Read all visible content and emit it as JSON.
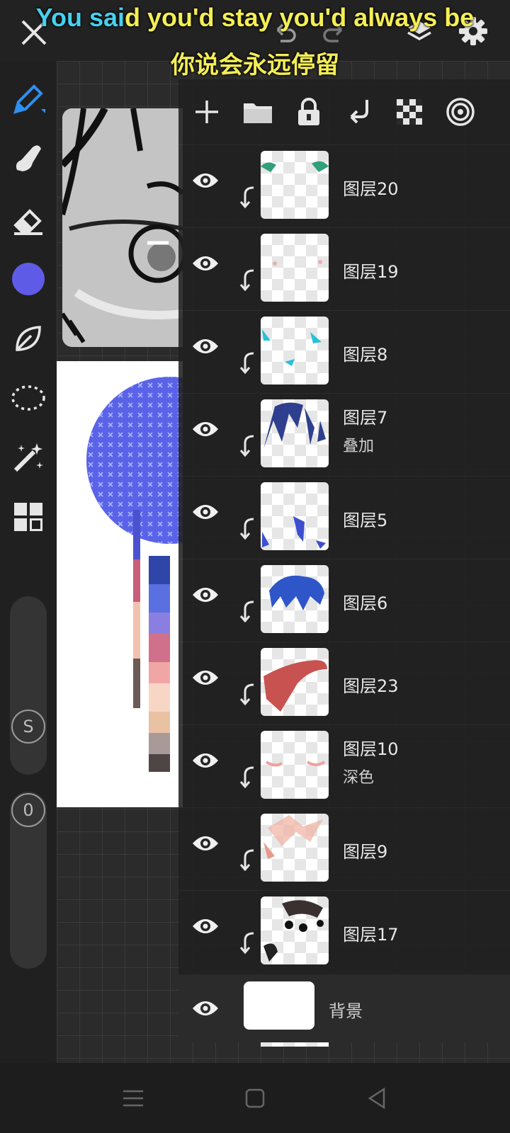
{
  "lyrics": {
    "line1_highlight": "You sai",
    "line1_rest": "d you'd stay you'd always be",
    "line2": "你说会永远停留"
  },
  "toolbar": {
    "brush_color": "#5e5ce6",
    "active_color": "#2f8ff0",
    "slider_size_label": "S",
    "slider_opacity_label": "0"
  },
  "layers": [
    {
      "name": "图层20",
      "mode": ""
    },
    {
      "name": "图层19",
      "mode": ""
    },
    {
      "name": "图层8",
      "mode": ""
    },
    {
      "name": "图层7",
      "mode": "叠加"
    },
    {
      "name": "图层5",
      "mode": ""
    },
    {
      "name": "图层6",
      "mode": ""
    },
    {
      "name": "图层23",
      "mode": ""
    },
    {
      "name": "图层10",
      "mode": "深色"
    },
    {
      "name": "图层9",
      "mode": ""
    },
    {
      "name": "图层17",
      "mode": ""
    }
  ],
  "background_layer": {
    "name": "背景"
  }
}
